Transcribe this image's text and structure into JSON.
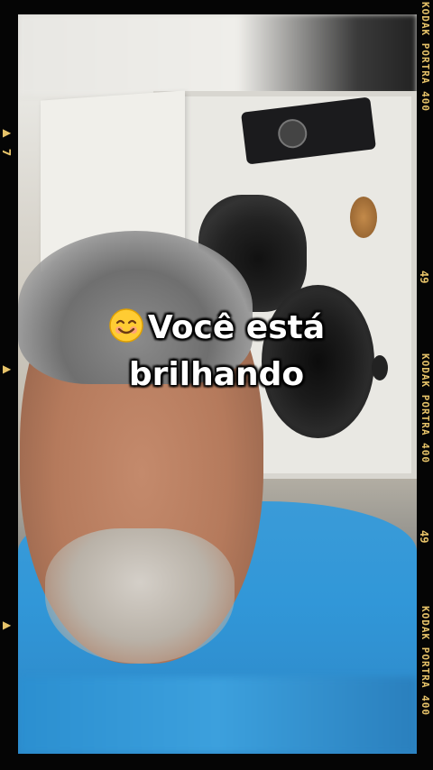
{
  "caption": {
    "line1": "Você está",
    "line2": "brilhando",
    "emoji_icon": "smiling-face-icon"
  },
  "film_edge": {
    "marks": [
      {
        "text": "KODAK PORTRA 400"
      },
      {
        "text": "49"
      },
      {
        "text": "KODAK PORTRA 400"
      },
      {
        "text": "49"
      },
      {
        "text": "KODAK PORTRA 400"
      }
    ],
    "left_marks": [
      {
        "text": "▶"
      },
      {
        "text": "7"
      },
      {
        "text": "▶"
      },
      {
        "text": "▶"
      }
    ],
    "color": "#e8c46a"
  },
  "colors": {
    "shirt": "#3197d8",
    "frame": "#050505"
  }
}
